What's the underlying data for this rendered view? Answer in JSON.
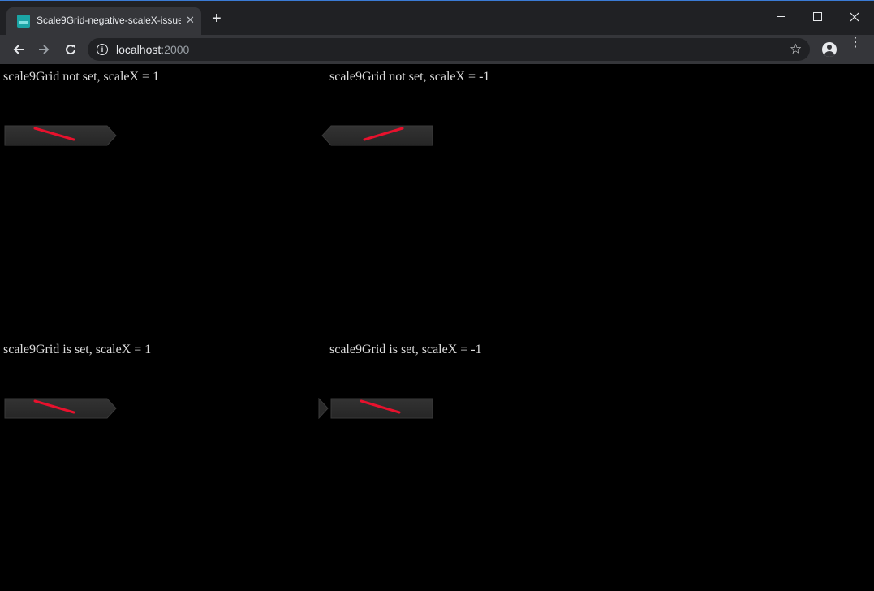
{
  "browser": {
    "tab_title": "Scale9Grid-negative-scaleX-issue",
    "tab_close": "✕",
    "new_tab": "+",
    "url_host": "localhost",
    "url_port": ":2000",
    "icons": [
      "close-icon",
      "plus-icon",
      "back-arrow-icon",
      "forward-arrow-icon",
      "reload-icon",
      "info-icon",
      "star-icon",
      "account-icon",
      "menu-icon"
    ]
  },
  "demo": {
    "label_top_left": "scale9Grid not set, scaleX = 1",
    "label_top_right": "scale9Grid not set, scaleX = -1",
    "label_bottom_left": "scale9Grid is set, scaleX = 1",
    "label_bottom_right": "scale9Grid is set, scaleX = -1"
  },
  "colors": {
    "page_background": "#000000",
    "sprite_fill": "#2c2c2c",
    "stripe": "#e8112d",
    "titlebar": "#202124",
    "toolbar": "#35363a"
  }
}
